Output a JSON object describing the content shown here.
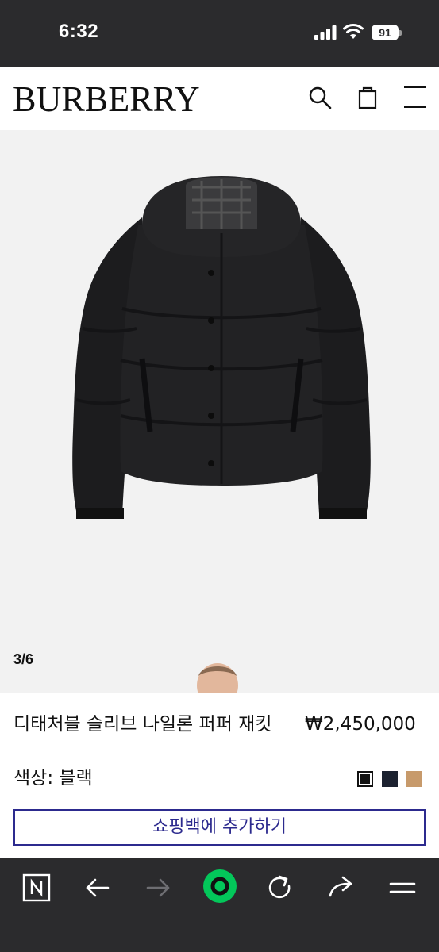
{
  "status_bar": {
    "time": "6:32",
    "battery": "91",
    "icons": [
      "signal-icon",
      "wifi-icon",
      "battery-icon"
    ]
  },
  "header": {
    "logo": "BURBERRY",
    "icons": [
      "search-icon",
      "shopping-bag-icon",
      "menu-icon"
    ]
  },
  "gallery": {
    "counter": "3/6"
  },
  "product": {
    "name": "디태처블 슬리브 나일론 퍼퍼 재킷",
    "price": "₩2,450,000",
    "color_label": "색상: 블랙",
    "swatches": [
      {
        "name": "black",
        "color": "#111111",
        "selected": true
      },
      {
        "name": "navy",
        "color": "#1c2230",
        "selected": false
      },
      {
        "name": "camel",
        "color": "#c79a6b",
        "selected": false
      }
    ],
    "add_to_bag_label": "쇼핑백에 추가하기"
  },
  "browser_toolbar": {
    "icons": [
      "naver-n-icon",
      "back-arrow-icon",
      "forward-arrow-icon",
      "home-circle-icon",
      "reload-icon",
      "share-icon",
      "menu-lines-icon"
    ]
  },
  "colors": {
    "accent": "#2c2a8e",
    "toolbar_bg": "#2b2b2d",
    "home_green": "#03c75a"
  }
}
